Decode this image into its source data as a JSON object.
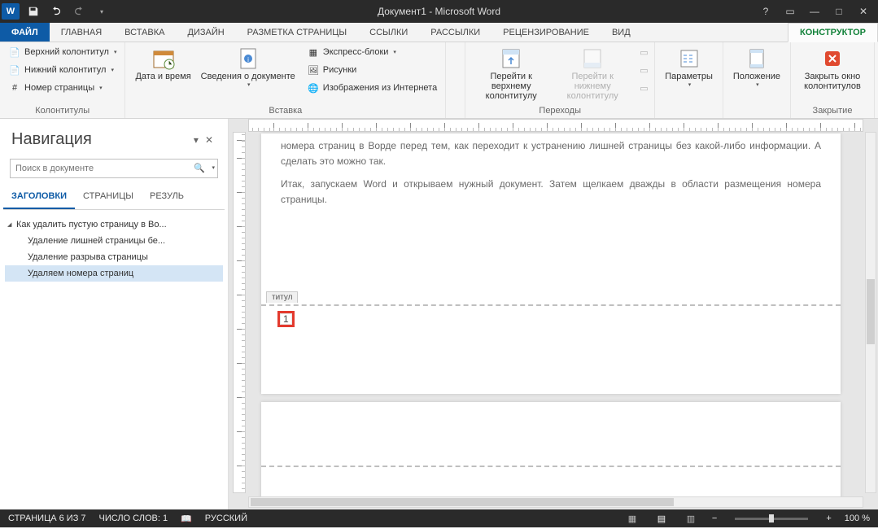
{
  "title": "Документ1 - Microsoft Word",
  "tabs": {
    "file": "ФАЙЛ",
    "home": "ГЛАВНАЯ",
    "insert": "ВСТАВКА",
    "design": "ДИЗАЙН",
    "layout": "РАЗМЕТКА СТРАНИЦЫ",
    "references": "ССЫЛКИ",
    "mailings": "РАССЫЛКИ",
    "review": "РЕЦЕНЗИРОВАНИЕ",
    "view": "ВИД",
    "designer": "КОНСТРУКТОР"
  },
  "ribbon": {
    "g1": {
      "label": "Колонтитулы",
      "header": "Верхний колонтитул",
      "footer": "Нижний колонтитул",
      "pagenum": "Номер страницы"
    },
    "g2": {
      "label": "Вставка",
      "date": "Дата и время",
      "docinfo": "Сведения о документе",
      "quick": "Экспресс-блоки",
      "pictures": "Рисунки",
      "online": "Изображения из Интернета",
      "separator": ""
    },
    "g3": {
      "label": "Переходы",
      "goheader": "Перейти к верхнему колонтитулу",
      "gofooter": "Перейти к нижнему колонтитулу"
    },
    "g4": {
      "label": "",
      "params": "Параметры"
    },
    "g5": {
      "label": "",
      "position": "Положение"
    },
    "g6": {
      "label": "Закрытие",
      "close": "Закрыть окно колонтитулов"
    }
  },
  "nav": {
    "title": "Навигация",
    "searchPlaceholder": "Поиск в документе",
    "tabs": {
      "headings": "ЗАГОЛОВКИ",
      "pages": "СТРАНИЦЫ",
      "results": "РЕЗУЛЬ"
    },
    "tree": {
      "i0": "Как удалить пустую страницу в Во...",
      "i1": "Удаление лишней страницы бе...",
      "i2": "Удаление разрыва страницы",
      "i3": "Удаляем номера страниц"
    }
  },
  "doc": {
    "p1": "номера страниц в Ворде перед тем, как переходит к устранению лишней страницы без какой-либо информации. А сделать это можно так.",
    "p2": "Итак, запускаем Word и открываем нужный документ. Затем щелкаем дважды в области размещения номера страницы.",
    "footerTag": "титул",
    "pageNumber": "1"
  },
  "status": {
    "page": "СТРАНИЦА 6 ИЗ 7",
    "words": "ЧИСЛО СЛОВ: 1",
    "lang": "РУССКИЙ",
    "zoom": "100 %"
  }
}
